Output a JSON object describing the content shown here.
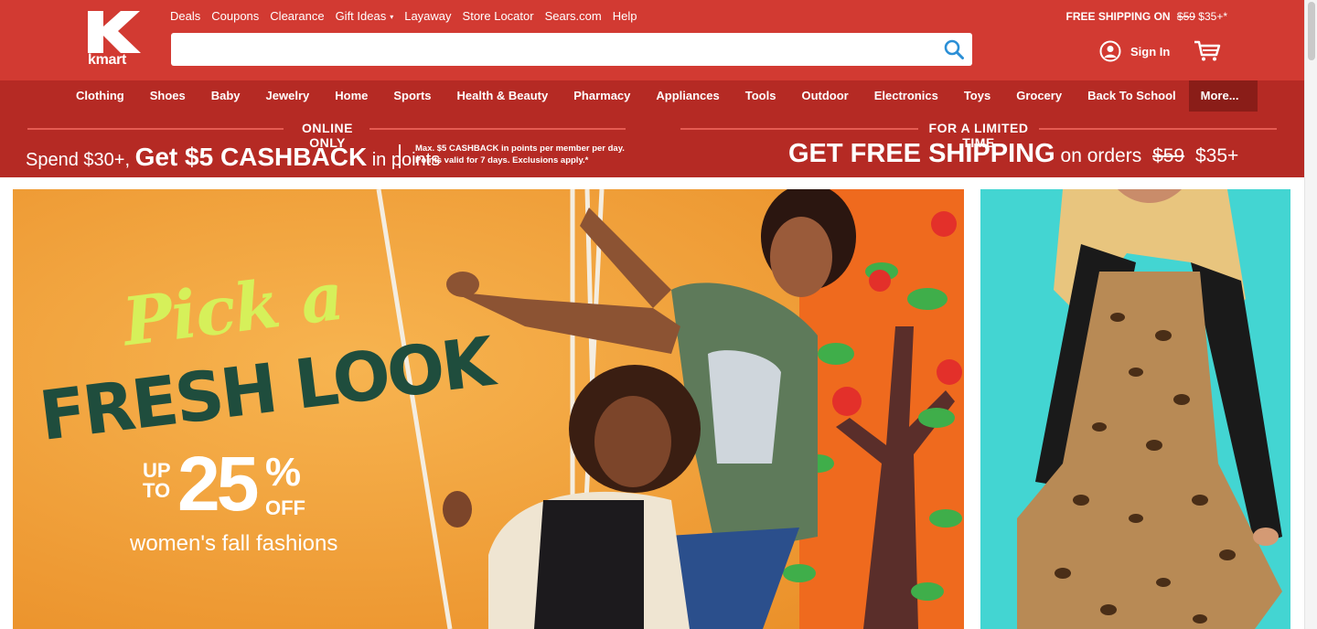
{
  "brand": {
    "logo_text": "kmart",
    "logo_letter": "K"
  },
  "top_links": [
    "Deals",
    "Coupons",
    "Clearance",
    "Gift Ideas",
    "Layaway",
    "Store Locator",
    "Sears.com",
    "Help"
  ],
  "gift_ideas_caret": "▾",
  "search": {
    "value": "",
    "placeholder": "",
    "icon": "search-icon"
  },
  "free_shipping": {
    "label": "FREE SHIPPING ON",
    "old_price": "$59",
    "new_price": "$35+*"
  },
  "account": {
    "sign_in_label": "Sign In",
    "icon": "user-icon",
    "cart_icon": "cart-icon"
  },
  "nav": [
    "Clothing",
    "Shoes",
    "Baby",
    "Jewelry",
    "Home",
    "Sports",
    "Health & Beauty",
    "Pharmacy",
    "Appliances",
    "Tools",
    "Outdoor",
    "Electronics",
    "Toys",
    "Grocery",
    "Back To School",
    "More..."
  ],
  "promo_left": {
    "caption": "ONLINE ONLY",
    "pre": "Spend $30+,",
    "bold": "Get $5 CASHBACK",
    "post": "in points",
    "fine_line1": "Max. $5 CASHBACK in points per member per day.",
    "fine_line2": "Points valid for 7 days. Exclusions apply.*"
  },
  "promo_right": {
    "caption": "FOR A LIMITED TIME",
    "bold": "GET FREE SHIPPING",
    "mid": "on orders",
    "old_price": "$59",
    "new_price": "$35+"
  },
  "hero": {
    "line1": "Pick a",
    "line2": "FRESH LOOK",
    "up_to": "UP TO",
    "percent_value": "25",
    "percent_symbol": "%",
    "off": "OFF",
    "subtitle": "women's fall fashions"
  },
  "colors": {
    "header_red": "#d23a32",
    "nav_red": "#b52a24",
    "more_bg": "#8a1d18",
    "hero_orange": "#f3a23b",
    "side_teal": "#43d5d2"
  }
}
